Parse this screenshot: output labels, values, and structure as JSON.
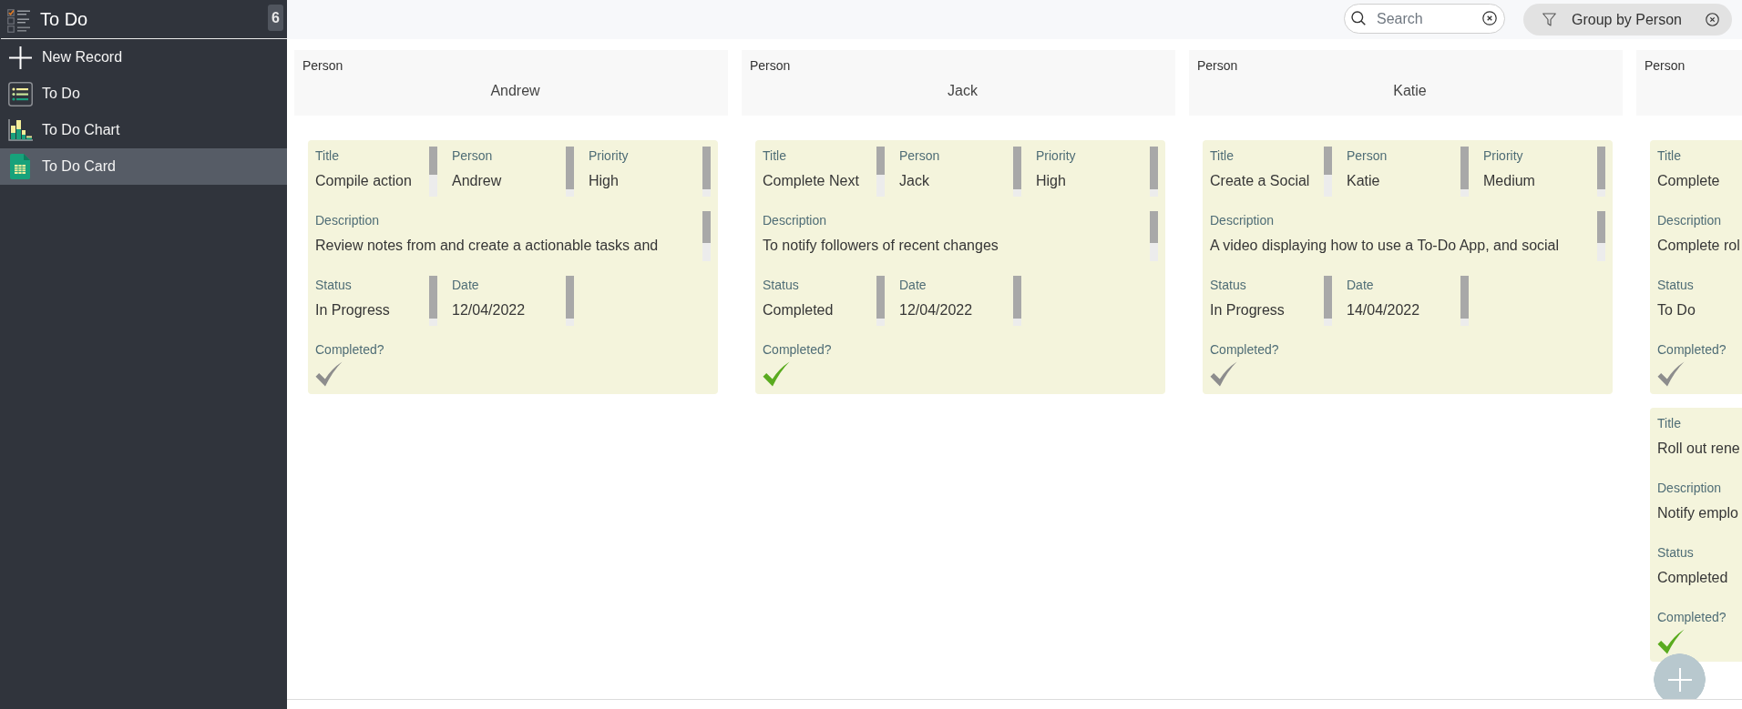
{
  "sidebar": {
    "header": {
      "title": "To Do",
      "badge": "6"
    },
    "items": [
      {
        "label": "New Record",
        "selected": false
      },
      {
        "label": "To Do",
        "selected": false
      },
      {
        "label": "To Do Chart",
        "selected": false
      },
      {
        "label": "To Do Card",
        "selected": true
      }
    ]
  },
  "toolbar": {
    "search": {
      "placeholder": "Search"
    },
    "group_chip": {
      "label": "Group by Person"
    }
  },
  "columns": [
    {
      "header": {
        "label": "Person",
        "value": "Andrew"
      },
      "cards": [
        {
          "fields": [
            {
              "kind": "short",
              "label": "Title",
              "value": "Compile action"
            },
            {
              "kind": "short",
              "label": "Person",
              "value": "Andrew"
            },
            {
              "kind": "short",
              "label": "Priority",
              "value": "High"
            },
            {
              "kind": "wide",
              "label": "Description",
              "value": "Review notes from and create a actionable tasks and"
            },
            {
              "kind": "short",
              "label": "Status",
              "value": "In Progress"
            },
            {
              "kind": "short",
              "label": "Date",
              "value": "12/04/2022"
            }
          ],
          "completed": {
            "label": "Completed?",
            "checked": false
          }
        }
      ]
    },
    {
      "header": {
        "label": "Person",
        "value": "Jack"
      },
      "cards": [
        {
          "fields": [
            {
              "kind": "short",
              "label": "Title",
              "value": "Complete Next"
            },
            {
              "kind": "short",
              "label": "Person",
              "value": "Jack"
            },
            {
              "kind": "short",
              "label": "Priority",
              "value": "High"
            },
            {
              "kind": "wide",
              "label": "Description",
              "value": "To notify followers of recent changes"
            },
            {
              "kind": "short",
              "label": "Status",
              "value": "Completed"
            },
            {
              "kind": "short",
              "label": "Date",
              "value": "12/04/2022"
            }
          ],
          "completed": {
            "label": "Completed?",
            "checked": true
          }
        }
      ]
    },
    {
      "header": {
        "label": "Person",
        "value": "Katie"
      },
      "cards": [
        {
          "fields": [
            {
              "kind": "short",
              "label": "Title",
              "value": "Create a Social"
            },
            {
              "kind": "short",
              "label": "Person",
              "value": "Katie"
            },
            {
              "kind": "short",
              "label": "Priority",
              "value": "Medium"
            },
            {
              "kind": "wide",
              "label": "Description",
              "value": "A video displaying how to use a To-Do App, and social"
            },
            {
              "kind": "short",
              "label": "Status",
              "value": "In Progress"
            },
            {
              "kind": "short",
              "label": "Date",
              "value": "14/04/2022"
            }
          ],
          "completed": {
            "label": "Completed?",
            "checked": false
          }
        }
      ]
    },
    {
      "header": {
        "label": "Person"
      },
      "cards": [
        {
          "fields": [
            {
              "kind": "short",
              "label": "Title",
              "value": "Complete"
            },
            {
              "kind": "wide",
              "label": "Description",
              "value": "Complete rol"
            },
            {
              "kind": "short",
              "label": "Status",
              "value": "To Do"
            }
          ],
          "completed": {
            "label": "Completed?",
            "checked": false
          }
        },
        {
          "fields": [
            {
              "kind": "short",
              "label": "Title",
              "value": "Roll out rene"
            },
            {
              "kind": "wide",
              "label": "Description",
              "value": "Notify emplo"
            },
            {
              "kind": "short",
              "label": "Status",
              "value": "Completed"
            }
          ],
          "completed": {
            "label": "Completed?",
            "checked": true
          }
        }
      ]
    }
  ]
}
